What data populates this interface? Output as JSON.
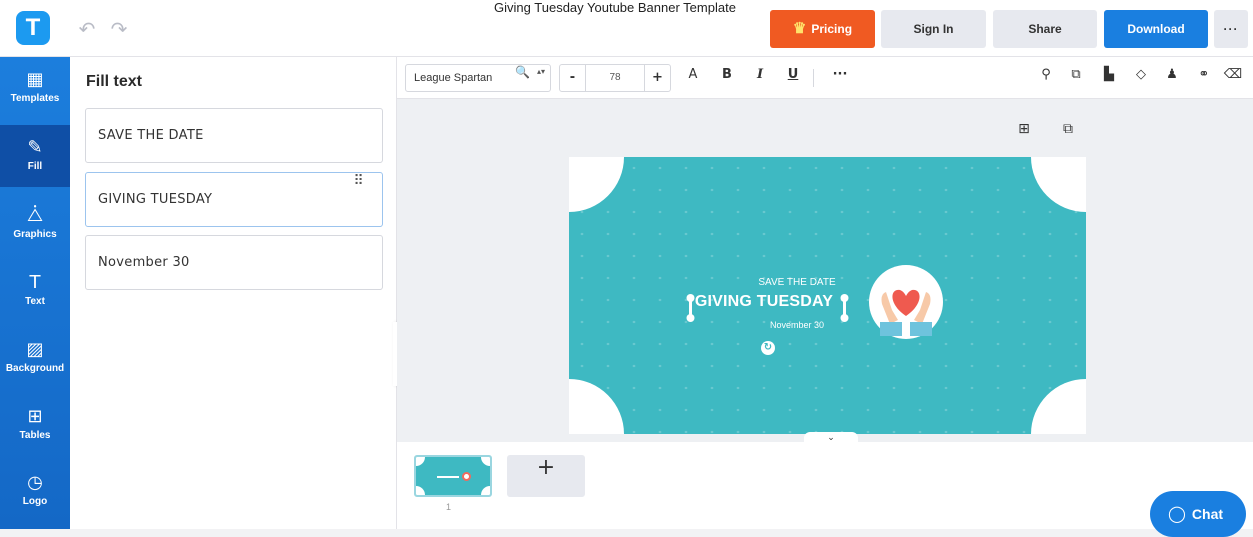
{
  "app": {
    "logo_letter": "T",
    "accent": "#1a7fe0",
    "pricing_color": "#f05a22",
    "banner_color": "#3eb9c2"
  },
  "header": {
    "title": "Giving Tuesday Youtube Banner Template",
    "undo_icon": "↶",
    "redo_icon": "↷",
    "pricing_icon": "♛",
    "pricing": "Pricing",
    "sign_in": "Sign In",
    "share": "Share",
    "download": "Download",
    "more": "···"
  },
  "sidebar": {
    "items": [
      {
        "label": "Templates",
        "icon": "▦"
      },
      {
        "label": "Fill",
        "icon": "✎"
      },
      {
        "label": "Graphics",
        "icon": "⧊"
      },
      {
        "label": "Text",
        "icon": "T"
      },
      {
        "label": "Background",
        "icon": "▨"
      },
      {
        "label": "Tables",
        "icon": "⊞"
      },
      {
        "label": "Logo",
        "icon": "◷"
      }
    ]
  },
  "panel": {
    "title": "Fill text",
    "fields": [
      {
        "value": "SAVE THE DATE"
      },
      {
        "value": "GIVING TUESDAY"
      },
      {
        "value": "November 30"
      }
    ],
    "drag_icon": "⠿",
    "collapse_icon": "‹"
  },
  "toolbar": {
    "font": "League Spartan",
    "search_icon": "🔍",
    "arrows": "▴▾",
    "minus": "-",
    "size": "78",
    "plus": "+",
    "case": "A",
    "bold": "B",
    "italic": "I",
    "underline": "U",
    "more": "···",
    "right_icons": [
      "⚲",
      "⧉",
      "▙",
      "◇",
      "♟",
      "⚭",
      "⌫"
    ]
  },
  "canvas": {
    "add_icon": "⊞",
    "copy_icon": "⧉",
    "expand_icon": "⌄",
    "banner": {
      "subtitle": "SAVE THE DATE",
      "title": "GIVING TUESDAY",
      "date": "November 30",
      "button_icon": "↻"
    }
  },
  "pages": {
    "page_number": "1",
    "add_icon": "+"
  },
  "chat": {
    "icon": "◯",
    "label": "Chat"
  }
}
